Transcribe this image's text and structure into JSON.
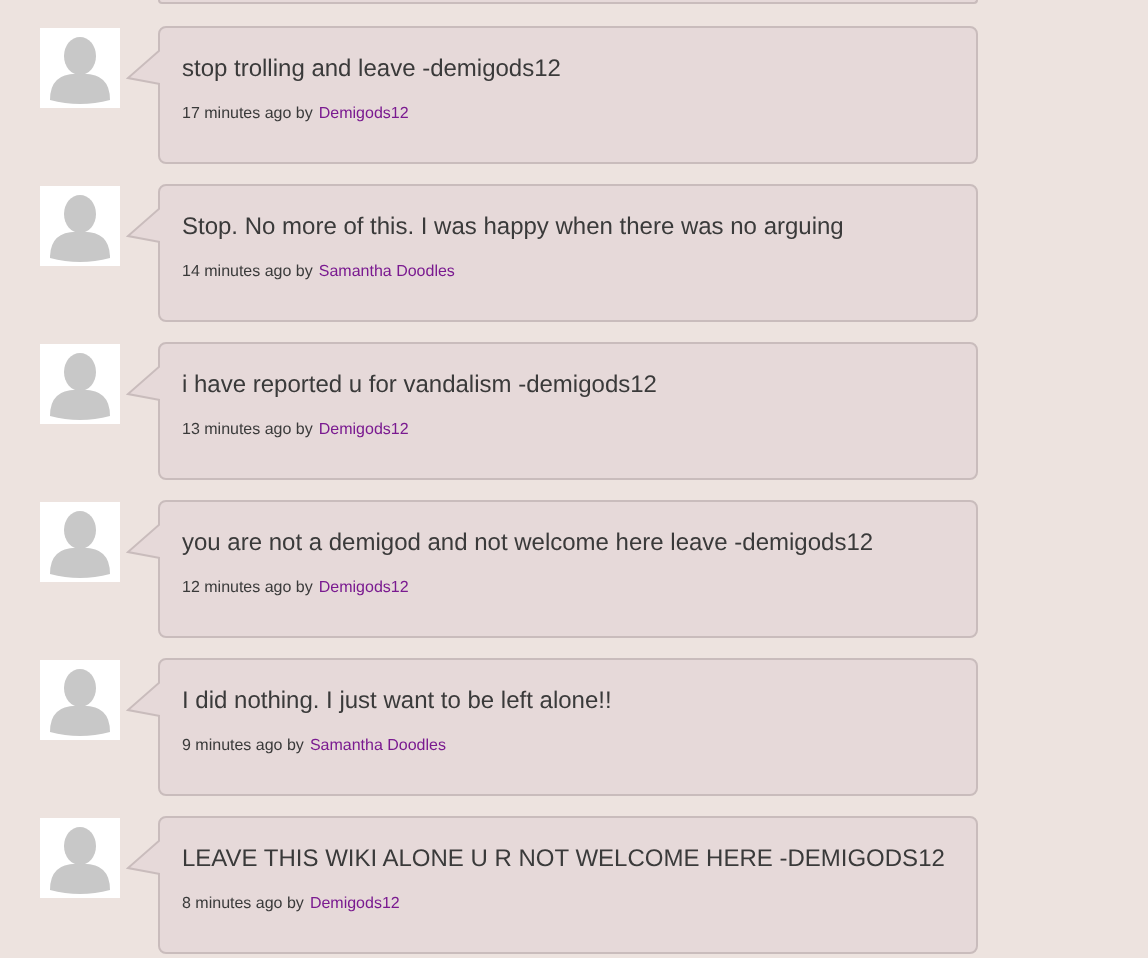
{
  "comments": [
    {
      "text": "stop trolling and leave -demigods12",
      "time": "17 minutes ago by",
      "author": "Demigods12"
    },
    {
      "text": "Stop. No more of this. I was happy when there was no arguing",
      "time": "14 minutes ago by",
      "author": "Samantha Doodles"
    },
    {
      "text": "i have reported u for vandalism -demigods12",
      "time": "13 minutes ago by",
      "author": "Demigods12"
    },
    {
      "text": "you are not a demigod and not welcome here leave -demigods12",
      "time": "12 minutes ago by",
      "author": "Demigods12"
    },
    {
      "text": "I did nothing. I just want to be left alone!!",
      "time": "9 minutes ago by",
      "author": "Samantha Doodles"
    },
    {
      "text": "LEAVE THIS WIKI ALONE U R NOT WELCOME HERE -DEMIGODS12",
      "time": "8 minutes ago by",
      "author": "Demigods12"
    }
  ]
}
